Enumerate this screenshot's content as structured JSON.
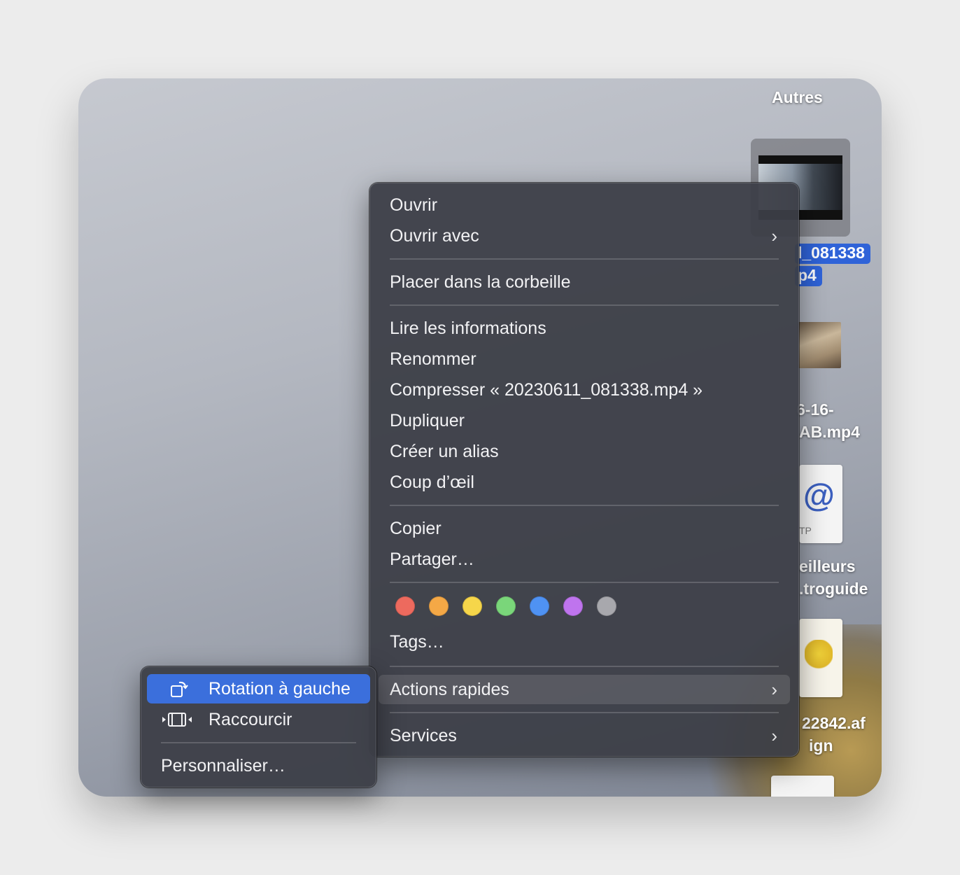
{
  "desktop": {
    "group_label": "Autres",
    "selected_file_line1": "l_081338",
    "selected_file_line2": "p4",
    "file2_line1": "6-16-",
    "file2_line2": "AB.mp4",
    "file3_line1": "eilleurs",
    "file3_line2": ".troguide",
    "file3_badge": "TP",
    "file4_line1": "22842.af",
    "file4_line2": "ign"
  },
  "context_menu": {
    "open": "Ouvrir",
    "open_with": "Ouvrir avec",
    "trash": "Placer dans la corbeille",
    "get_info": "Lire les informations",
    "rename": "Renommer",
    "compress": "Compresser « 20230611_081338.mp4 »",
    "duplicate": "Dupliquer",
    "make_alias": "Créer un alias",
    "quick_look": "Coup d’œil",
    "copy": "Copier",
    "share": "Partager…",
    "tags": "Tags…",
    "quick_actions": "Actions rapides",
    "services": "Services",
    "tag_colors": [
      "#ed6a5e",
      "#f4a846",
      "#f6d64a",
      "#7ad67a",
      "#4f92f3",
      "#bf74ee",
      "#a8a8ad"
    ]
  },
  "submenu": {
    "rotate_left": "Rotation à gauche",
    "trim": "Raccourcir",
    "customize": "Personnaliser…"
  }
}
